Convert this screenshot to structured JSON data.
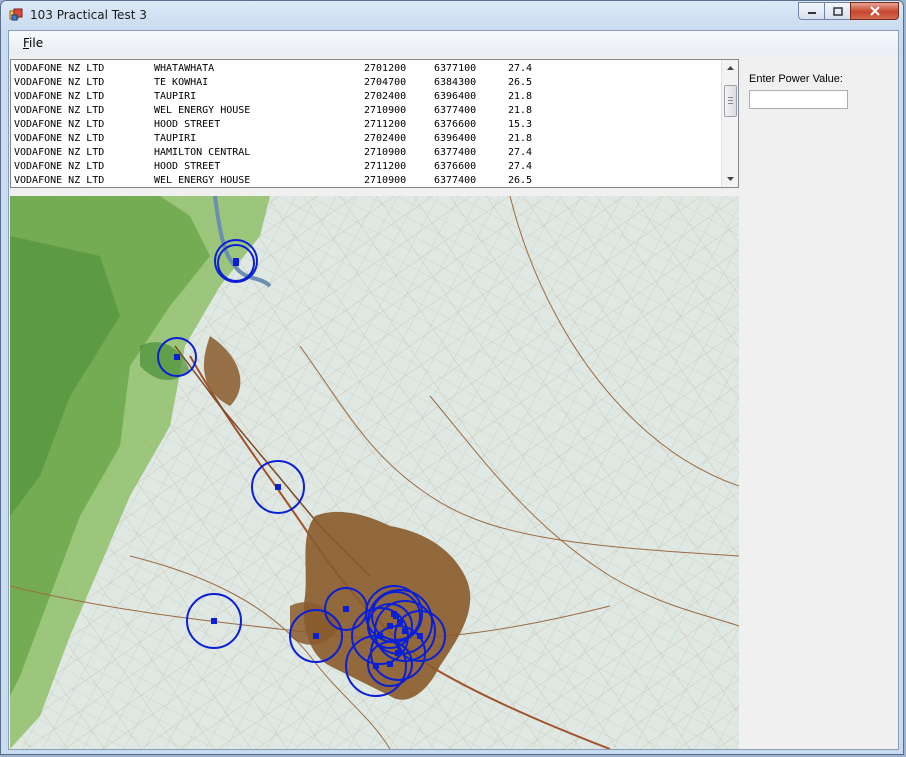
{
  "window": {
    "title": "103 Practical Test 3"
  },
  "menu": {
    "file": "File",
    "file_accel": "F",
    "file_rest": "ile"
  },
  "power": {
    "label": "Enter Power Value:",
    "value": ""
  },
  "listing": [
    {
      "owner": "VODAFONE NZ LTD",
      "site": "WHATAWHATA",
      "easting": "2701200",
      "northing": "6377100",
      "power": "27.4"
    },
    {
      "owner": "VODAFONE NZ LTD",
      "site": "TE KOWHAI",
      "easting": "2704700",
      "northing": "6384300",
      "power": "26.5"
    },
    {
      "owner": "VODAFONE NZ LTD",
      "site": "TAUPIRI",
      "easting": "2702400",
      "northing": "6396400",
      "power": "21.8"
    },
    {
      "owner": "VODAFONE NZ LTD",
      "site": "WEL ENERGY HOUSE",
      "easting": "2710900",
      "northing": "6377400",
      "power": "21.8"
    },
    {
      "owner": "VODAFONE NZ LTD",
      "site": "HOOD STREET",
      "easting": "2711200",
      "northing": "6376600",
      "power": "15.3"
    },
    {
      "owner": "VODAFONE NZ LTD",
      "site": "TAUPIRI",
      "easting": "2702400",
      "northing": "6396400",
      "power": "21.8"
    },
    {
      "owner": "VODAFONE NZ LTD",
      "site": "HAMILTON CENTRAL",
      "easting": "2710900",
      "northing": "6377400",
      "power": "27.4"
    },
    {
      "owner": "VODAFONE NZ LTD",
      "site": "HOOD STREET",
      "easting": "2711200",
      "northing": "6376600",
      "power": "27.4"
    },
    {
      "owner": "VODAFONE NZ LTD",
      "site": "WEL ENERGY HOUSE",
      "easting": "2710900",
      "northing": "6377400",
      "power": "26.5"
    }
  ],
  "scrollbar": {
    "position": 0.12
  },
  "colors": {
    "marker": "#0b1fd6",
    "urban": "#8a5a2b",
    "terrain": "#dfe8e2",
    "hills": "#6aa548"
  },
  "icons": {
    "app": "app-icon",
    "minimize": "minimize-icon",
    "maximize": "maximize-icon",
    "close": "close-icon",
    "scroll_up": "chevron-up-icon",
    "scroll_down": "chevron-down-icon"
  }
}
